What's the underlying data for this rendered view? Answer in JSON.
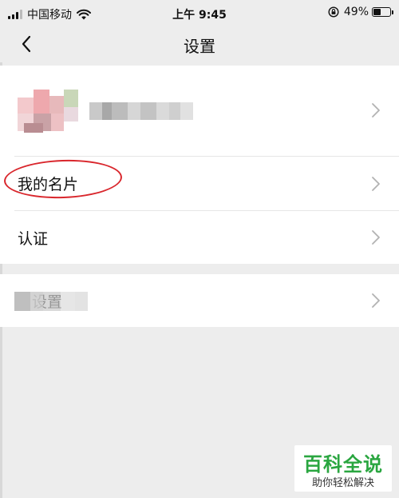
{
  "status_bar": {
    "carrier": "中国移动",
    "time": "上午 9:45",
    "battery_percent": "49%",
    "battery_level": 0.49,
    "icons": [
      "signal-icon",
      "wifi-icon",
      "rotation-lock-icon",
      "battery-icon"
    ]
  },
  "nav": {
    "title": "设置",
    "back_icon": "chevron-left-icon"
  },
  "profile": {
    "avatar": "blurred-avatar",
    "name": "blurred"
  },
  "menu": {
    "my_card": "我的名片",
    "certification": "认证",
    "privacy_settings_visible": "设置",
    "chevron_icon": "chevron-right-icon"
  },
  "annotation": {
    "shape": "red-ellipse",
    "color": "#d9262c",
    "target": "我的名片"
  },
  "watermark": {
    "title": "百科全说",
    "subtitle": "助你轻松解决",
    "color": "#2aa640"
  },
  "colors": {
    "background": "#ededed",
    "card": "#ffffff",
    "divider": "#e6e6e6",
    "chevron": "#b2b2b2"
  }
}
